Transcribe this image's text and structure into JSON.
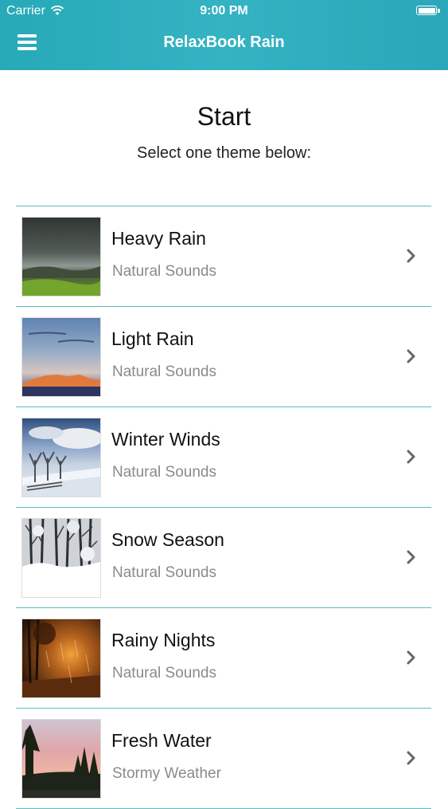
{
  "status_bar": {
    "carrier": "Carrier",
    "time": "9:00 PM"
  },
  "nav": {
    "title": "RelaxBook Rain",
    "menu_icon": "hamburger-menu-icon"
  },
  "intro": {
    "title": "Start",
    "subtitle": "Select one theme below:"
  },
  "themes": [
    {
      "title": "Heavy Rain",
      "subtitle": "Natural Sounds"
    },
    {
      "title": "Light Rain",
      "subtitle": "Natural Sounds"
    },
    {
      "title": "Winter Winds",
      "subtitle": "Natural Sounds"
    },
    {
      "title": "Snow Season",
      "subtitle": "Natural Sounds"
    },
    {
      "title": "Rainy Nights",
      "subtitle": "Natural Sounds"
    },
    {
      "title": "Fresh Water",
      "subtitle": "Stormy Weather"
    }
  ],
  "colors": {
    "header_gradient_start": "#27a9b7",
    "header_gradient_end": "#2aa7b8",
    "divider": "#5bbdbd",
    "subtitle_text": "#8a8a8a"
  }
}
